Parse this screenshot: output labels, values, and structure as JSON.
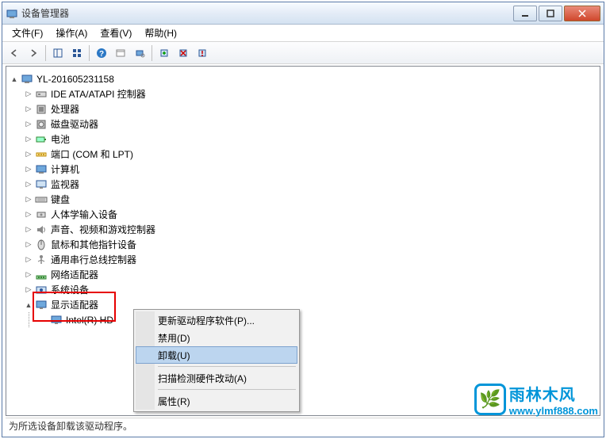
{
  "window": {
    "title": "设备管理器"
  },
  "menubar": [
    {
      "label": "文件(F)"
    },
    {
      "label": "操作(A)"
    },
    {
      "label": "查看(V)"
    },
    {
      "label": "帮助(H)"
    }
  ],
  "tree": {
    "root": "YL-201605231158",
    "nodes": [
      {
        "label": "IDE ATA/ATAPI 控制器",
        "icon": "controller"
      },
      {
        "label": "处理器",
        "icon": "cpu"
      },
      {
        "label": "磁盘驱动器",
        "icon": "disk"
      },
      {
        "label": "电池",
        "icon": "battery"
      },
      {
        "label": "端口 (COM 和 LPT)",
        "icon": "port"
      },
      {
        "label": "计算机",
        "icon": "computer"
      },
      {
        "label": "监视器",
        "icon": "monitor"
      },
      {
        "label": "键盘",
        "icon": "keyboard"
      },
      {
        "label": "人体学输入设备",
        "icon": "hid"
      },
      {
        "label": "声音、视频和游戏控制器",
        "icon": "sound"
      },
      {
        "label": "鼠标和其他指针设备",
        "icon": "mouse"
      },
      {
        "label": "通用串行总线控制器",
        "icon": "usb"
      },
      {
        "label": "网络适配器",
        "icon": "network"
      },
      {
        "label": "系统设备",
        "icon": "system"
      }
    ],
    "display_adapter": {
      "label": "显示适配器",
      "child": "Intel(R) HD"
    }
  },
  "context_menu": {
    "update": "更新驱动程序软件(P)...",
    "disable": "禁用(D)",
    "uninstall": "卸载(U)",
    "scan": "扫描检测硬件改动(A)",
    "properties": "属性(R)"
  },
  "statusbar": {
    "text": "为所选设备卸载该驱动程序。"
  },
  "watermark": {
    "cn": "雨林木风",
    "url": "www.ylmf888.com"
  }
}
